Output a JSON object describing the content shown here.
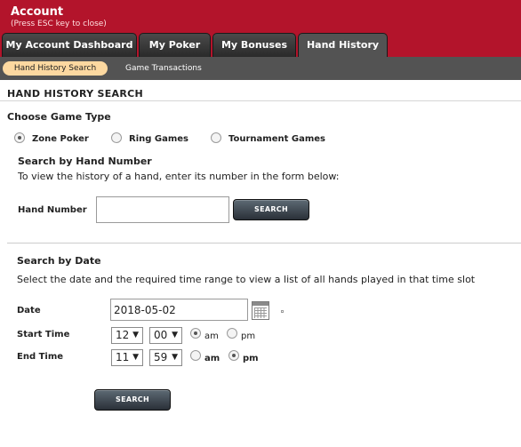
{
  "header": {
    "title": "Account",
    "subtitle": "(Press ESC key to close)",
    "tabs": [
      {
        "label": "My Account Dashboard"
      },
      {
        "label": "My Poker"
      },
      {
        "label": "My Bonuses"
      },
      {
        "label": "Hand History"
      }
    ],
    "active_tab": "Hand History"
  },
  "subnav": {
    "items": [
      {
        "label": "Hand History Search"
      },
      {
        "label": "Game Transactions"
      }
    ],
    "active": "Hand History Search"
  },
  "main": {
    "section_title": "HAND HISTORY SEARCH",
    "game_type": {
      "label": "Choose Game Type",
      "options": [
        {
          "label": "Zone Poker",
          "checked": true
        },
        {
          "label": "Ring Games",
          "checked": false
        },
        {
          "label": "Tournament Games",
          "checked": false
        }
      ]
    },
    "by_hand": {
      "title": "Search by Hand Number",
      "description": "To view the history of a hand, enter its number in the form below:",
      "field_label": "Hand Number",
      "value": "",
      "button": "SEARCH"
    },
    "by_date": {
      "title": "Search by Date",
      "description": "Select the date and the required time range to view a list of all hands played in that time slot",
      "date_label": "Date",
      "date_value": "2018-05-02",
      "start_label": "Start Time",
      "start_hour": "12",
      "start_min": "00",
      "start_ampm": "am",
      "end_label": "End Time",
      "end_hour": "11",
      "end_min": "59",
      "end_ampm": "pm",
      "am": "am",
      "pm": "pm",
      "button": "SEARCH"
    }
  },
  "colors": {
    "header_red": "#b3142b",
    "nav_gray": "#535353",
    "active_subtab": "#fcd8a0"
  }
}
